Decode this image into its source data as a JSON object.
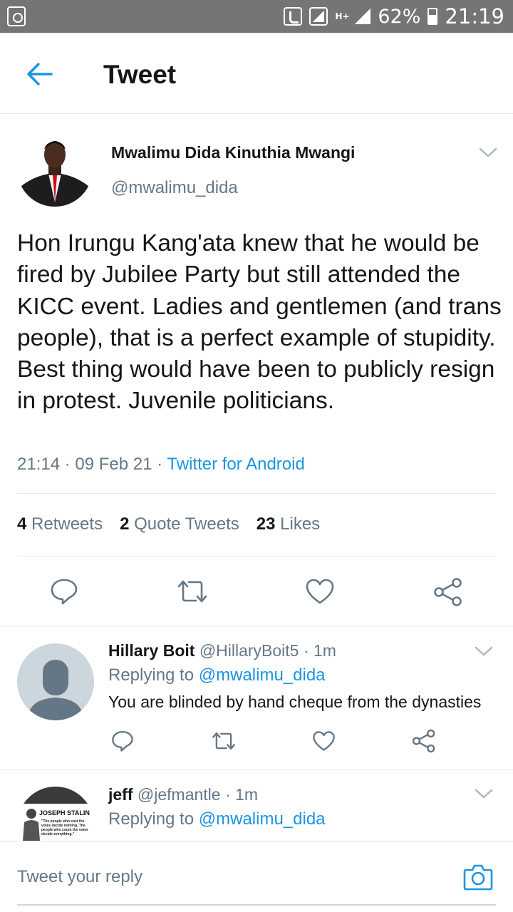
{
  "status_bar": {
    "battery": "62%",
    "network": "H+",
    "time": "21:19"
  },
  "header": {
    "title": "Tweet"
  },
  "tweet": {
    "author_name": "Mwalimu Dida Kinuthia Mwangi",
    "author_handle": "@mwalimu_dida",
    "text": "Hon Irungu Kang'ata knew that he would be fired by Jubilee Party but still attended the KICC event. Ladies and gentlemen (and trans people), that is a perfect example of stupidity. Best thing would have been to publicly resign in protest. Juvenile politicians.",
    "time": "21:14",
    "date": "09 Feb 21",
    "source": "Twitter for Android",
    "stats": {
      "retweets_count": "4",
      "retweets_label": "Retweets",
      "quotes_count": "2",
      "quotes_label": "Quote Tweets",
      "likes_count": "23",
      "likes_label": "Likes"
    }
  },
  "replies": [
    {
      "name": "Hillary Boit",
      "handle": "@HillaryBoit5",
      "time": "1m",
      "replying_label": "Replying to",
      "replying_to": "@mwalimu_dida",
      "text": "You are blinded by hand cheque from the dynasties"
    },
    {
      "name": "jeff",
      "handle": "@jefmantle",
      "time": "1m",
      "replying_label": "Replying to",
      "replying_to": "@mwalimu_dida",
      "avatar_caption_title": "JOSEPH STALIN",
      "avatar_caption_quote": "\"The people who cast the votes decide nothing. The people who count the votes decide everything.\""
    }
  ],
  "compose": {
    "placeholder": "Tweet your reply"
  },
  "colors": {
    "accent": "#1b95e0",
    "text_primary": "#14171a",
    "text_secondary": "#657786",
    "divider": "#e1e8ed",
    "status_bar": "#757575"
  }
}
